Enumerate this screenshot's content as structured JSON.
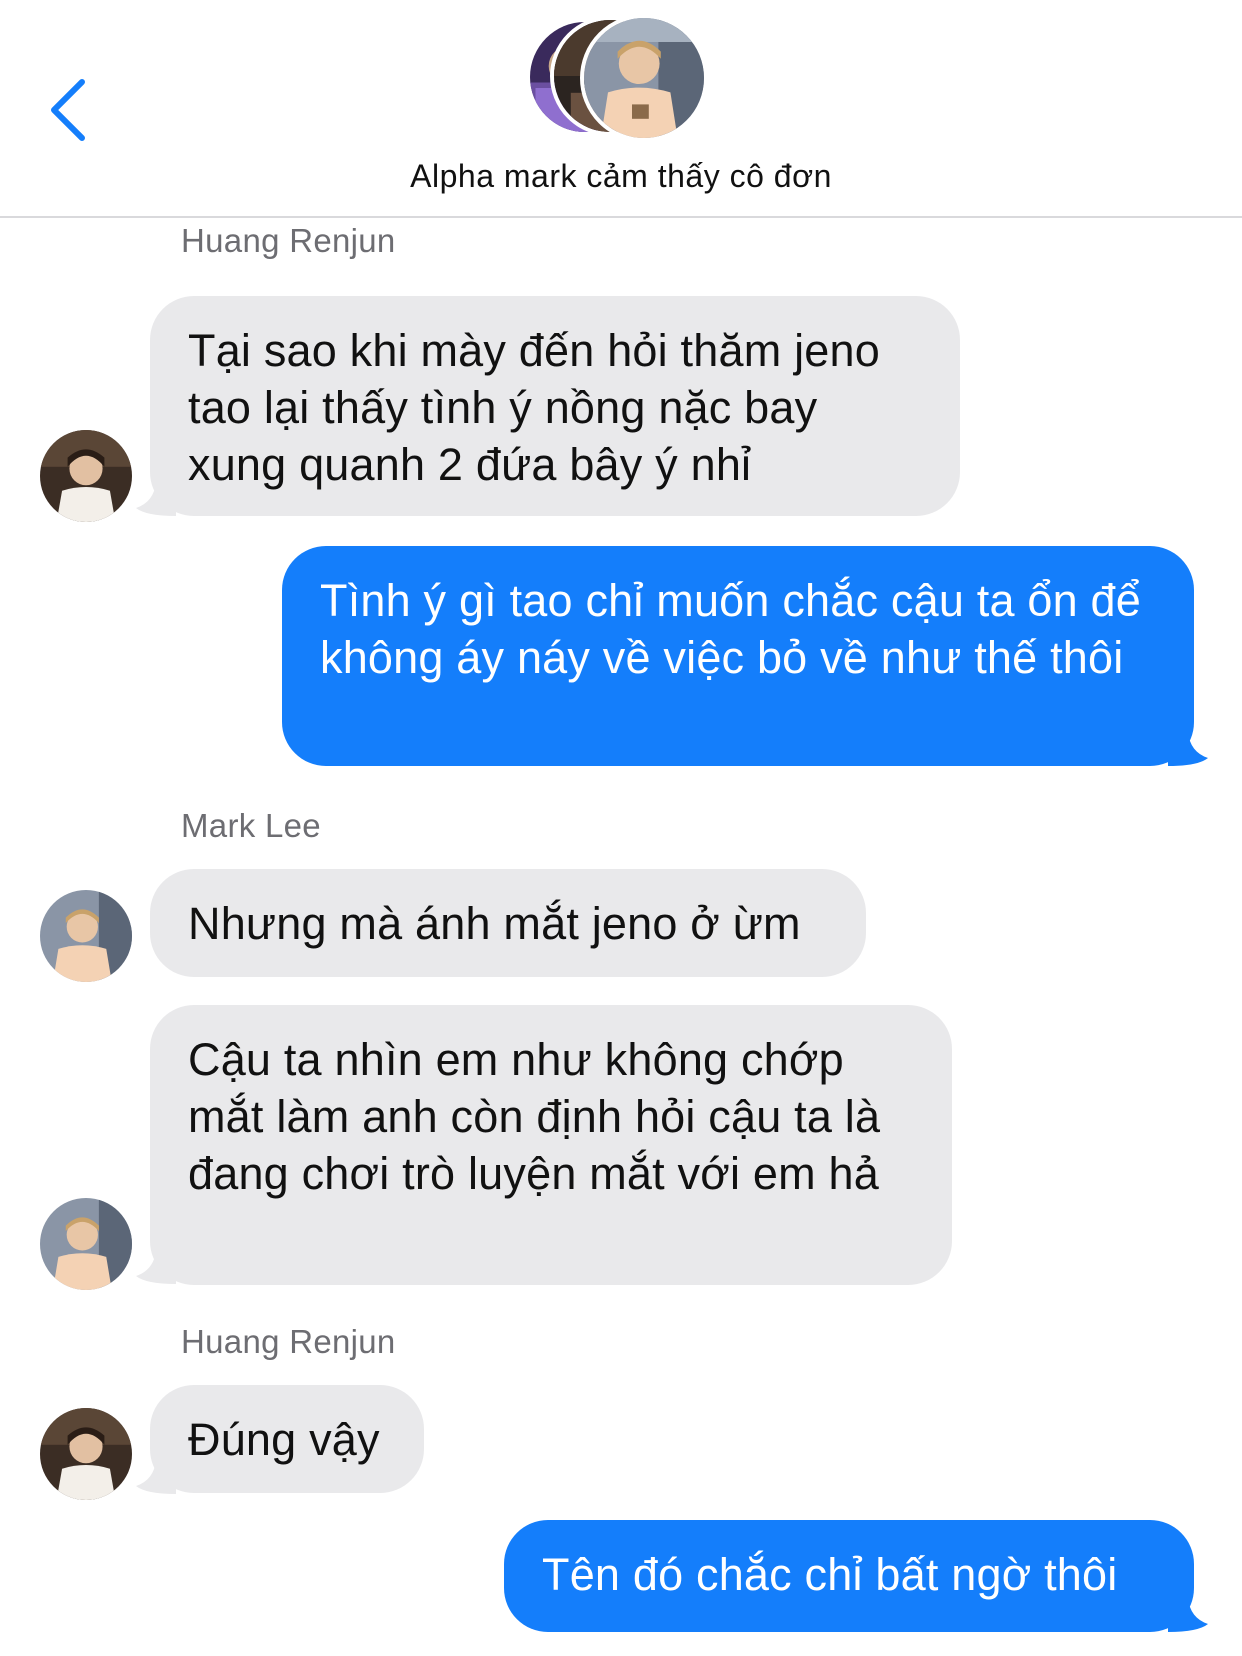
{
  "header": {
    "back_icon": "chevron-left-icon",
    "title": "Alpha mark cảm thấy cô đơn",
    "accent_color": "#147efb"
  },
  "colors": {
    "incoming_bubble": "#e9e9eb",
    "outgoing_bubble": "#147efb",
    "sender_label": "#6d6d72"
  },
  "messages": [
    {
      "id": 1,
      "direction": "incoming",
      "sender_label": "Huang Renjun",
      "text": "Tại sao khi mày đến hỏi thăm jeno tao lại thấy tình ý nồng nặc bay xung quanh 2 đứa bây ý nhỉ"
    },
    {
      "id": 2,
      "direction": "outgoing",
      "text": "Tình ý gì tao chỉ muốn chắc cậu ta ổn để không áy náy về việc bỏ về như thế thôi"
    },
    {
      "id": 3,
      "direction": "incoming",
      "sender_label": "Mark Lee",
      "text": "Nhưng mà ánh mắt jeno ở ừm"
    },
    {
      "id": 4,
      "direction": "incoming",
      "text": "Cậu ta nhìn em như không chớp mắt làm anh còn định hỏi cậu ta là đang chơi trò luyện mắt với em hả"
    },
    {
      "id": 5,
      "direction": "incoming",
      "sender_label": "Huang Renjun",
      "text": "Đúng vậy"
    },
    {
      "id": 6,
      "direction": "outgoing",
      "text": "Tên đó chắc chỉ bất ngờ thôi"
    }
  ]
}
